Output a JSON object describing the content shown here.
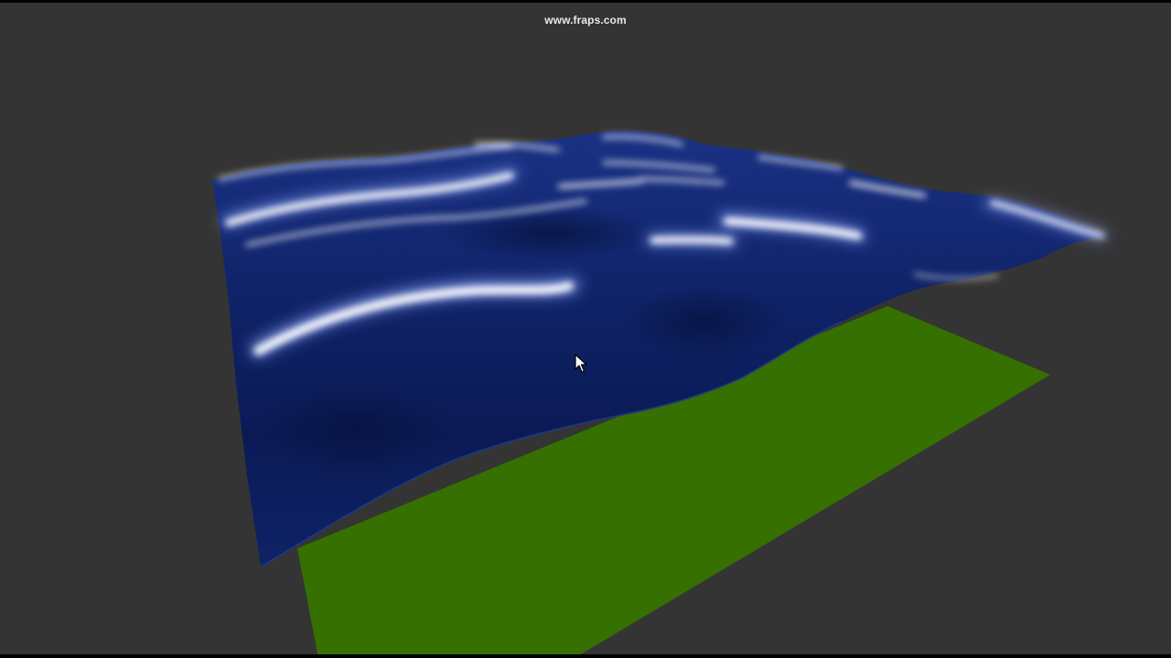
{
  "overlay": {
    "watermark": "www.fraps.com"
  },
  "scene": {
    "background_color": "#343434",
    "ground_plane_color": "#367000",
    "water_surface_color": "#0d2160",
    "highlight_color": "#ffffff"
  },
  "cursor": {
    "icon": "mouse-pointer-icon"
  }
}
